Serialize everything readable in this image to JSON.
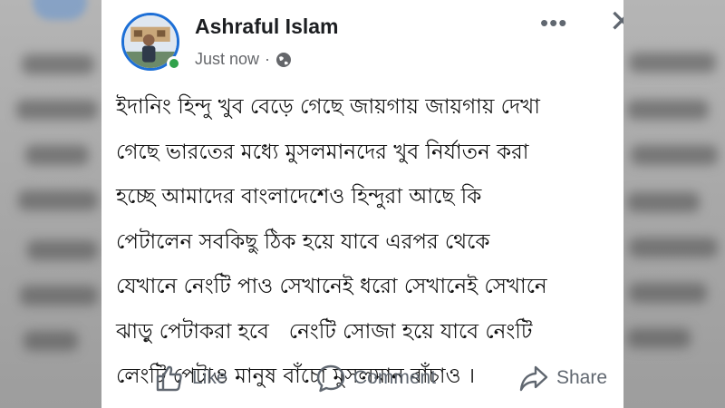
{
  "post": {
    "author": "Ashraful Islam",
    "timestamp": "Just now",
    "separator": "·",
    "more_icon": "•••",
    "close_icon": "✕",
    "text": "ইদানিং হিন্দু খুব বেড়ে গেছে জায়গায় জায়গায় দেখা\nগেছে ভারতের মধ্যে মুসলমানদের খুব নির্যাতন করা\nহচ্ছে আমাদের বাংলাদেশেও হিন্দুরা আছে কি\nপেটালেন সবকিছু ঠিক হয়ে যাবে এরপর থেকে\nযেখানে নেংটি পাও সেখানেই ধরো সেখানেই সেখানে\nঝাড়ু পেটাকরা হবে   নেংটি সোজা হয়ে যাবে নেংটি\nলেংটি পেটাও মানুষ বাঁচো মুসলমান বাঁচাও ।"
  },
  "actions": {
    "like": "Like",
    "comment": "Comment",
    "share": "Share"
  },
  "colors": {
    "avatar_ring": "#1d6fd6",
    "online": "#31a24c",
    "secondary_text": "#65676b",
    "action_text": "#606770"
  },
  "icons": {
    "globe": "globe-icon",
    "like": "thumbs-up-icon",
    "comment": "comment-bubble-icon",
    "share": "share-arrow-icon"
  }
}
